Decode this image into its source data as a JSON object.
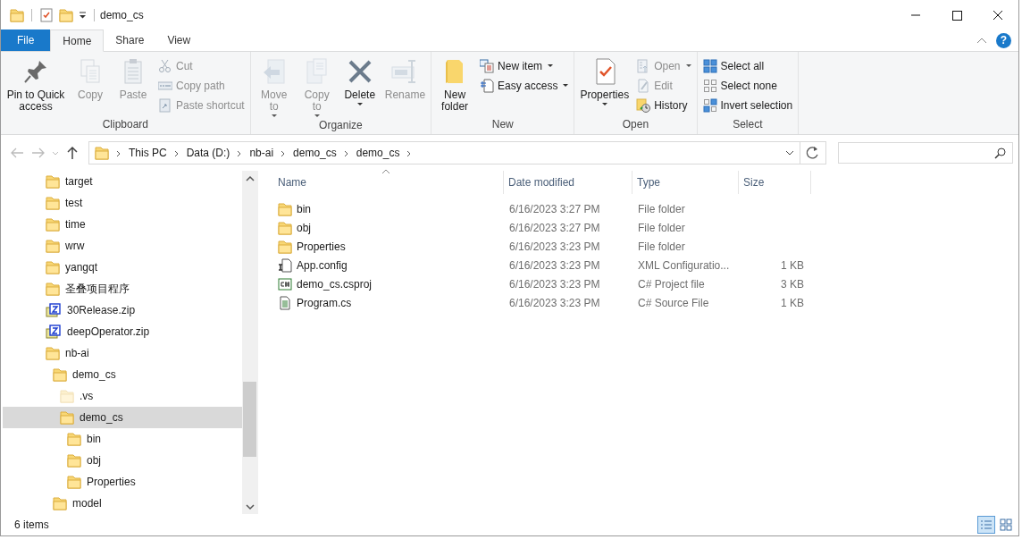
{
  "window": {
    "title": "demo_cs"
  },
  "ribbon_tabs": [
    {
      "label": "File",
      "kind": "file",
      "selected": false
    },
    {
      "label": "Home",
      "kind": "tab",
      "selected": true
    },
    {
      "label": "Share",
      "kind": "tab",
      "selected": false
    },
    {
      "label": "View",
      "kind": "tab",
      "selected": false
    }
  ],
  "help": "?",
  "ribbon_groups": [
    {
      "label": "Clipboard",
      "items": [
        {
          "kind": "large",
          "label": "Pin to Quick access",
          "disabled": false,
          "dropdown": false
        },
        {
          "kind": "large",
          "label": "Copy",
          "disabled": true,
          "dropdown": false
        },
        {
          "kind": "large",
          "label": "Paste",
          "disabled": true,
          "dropdown": false
        },
        {
          "kind": "small",
          "label": "Cut",
          "disabled": true,
          "dropdown": false
        },
        {
          "kind": "small",
          "label": "Copy path",
          "disabled": true,
          "dropdown": false
        },
        {
          "kind": "small",
          "label": "Paste shortcut",
          "disabled": true,
          "dropdown": false
        }
      ]
    },
    {
      "label": "Organize",
      "items": [
        {
          "kind": "large",
          "label": "Move to",
          "disabled": true,
          "dropdown": true
        },
        {
          "kind": "large",
          "label": "Copy to",
          "disabled": true,
          "dropdown": true
        },
        {
          "kind": "large",
          "label": "Delete",
          "disabled": false,
          "dropdown": true
        },
        {
          "kind": "large",
          "label": "Rename",
          "disabled": true,
          "dropdown": false
        }
      ]
    },
    {
      "label": "New",
      "items": [
        {
          "kind": "large",
          "label": "New folder",
          "disabled": false,
          "dropdown": false
        },
        {
          "kind": "small",
          "label": "New item",
          "disabled": false,
          "dropdown": true
        },
        {
          "kind": "small",
          "label": "Easy access",
          "disabled": false,
          "dropdown": true
        }
      ]
    },
    {
      "label": "Open",
      "items": [
        {
          "kind": "large",
          "label": "Properties",
          "disabled": false,
          "dropdown": true
        },
        {
          "kind": "small",
          "label": "Open",
          "disabled": true,
          "dropdown": true
        },
        {
          "kind": "small",
          "label": "Edit",
          "disabled": true,
          "dropdown": false
        },
        {
          "kind": "small",
          "label": "History",
          "disabled": false,
          "dropdown": false
        }
      ]
    },
    {
      "label": "Select",
      "items": [
        {
          "kind": "small",
          "label": "Select all",
          "disabled": false,
          "dropdown": false
        },
        {
          "kind": "small",
          "label": "Select none",
          "disabled": false,
          "dropdown": false
        },
        {
          "kind": "small",
          "label": "Invert selection",
          "disabled": false,
          "dropdown": false
        }
      ]
    }
  ],
  "address": {
    "segments": [
      "This PC",
      "Data (D:)",
      "nb-ai",
      "demo_cs",
      "demo_cs"
    ]
  },
  "nav_tree": [
    {
      "label": "target",
      "kind": "folder",
      "selected": false
    },
    {
      "label": "test",
      "kind": "folder",
      "selected": false
    },
    {
      "label": "time",
      "kind": "folder",
      "selected": false
    },
    {
      "label": "wrw",
      "kind": "folder",
      "selected": false
    },
    {
      "label": "yangqt",
      "kind": "folder",
      "selected": false
    },
    {
      "label": "圣叠项目程序",
      "kind": "folder",
      "selected": false
    },
    {
      "label": "30Release.zip",
      "kind": "zip",
      "selected": false
    },
    {
      "label": "deepOperator.zip",
      "kind": "zip",
      "selected": false
    },
    {
      "label": "nb-ai",
      "kind": "folder",
      "selected": false,
      "children": [
        {
          "label": "demo_cs",
          "kind": "folder",
          "selected": false,
          "children": [
            {
              "label": ".vs",
              "kind": "hidden-folder",
              "selected": false
            },
            {
              "label": "demo_cs",
              "kind": "folder",
              "selected": true,
              "children": [
                {
                  "label": "bin",
                  "kind": "folder",
                  "selected": false
                },
                {
                  "label": "obj",
                  "kind": "folder",
                  "selected": false
                },
                {
                  "label": "Properties",
                  "kind": "folder",
                  "selected": false
                }
              ]
            }
          ]
        },
        {
          "label": "model",
          "kind": "folder",
          "selected": false
        }
      ]
    }
  ],
  "table": {
    "columns": [
      "Name",
      "Date modified",
      "Type",
      "Size"
    ],
    "rows": [
      {
        "name": "bin",
        "date": "6/16/2023 3:27 PM",
        "type": "File folder",
        "size": "",
        "kind": "folder"
      },
      {
        "name": "obj",
        "date": "6/16/2023 3:27 PM",
        "type": "File folder",
        "size": "",
        "kind": "folder"
      },
      {
        "name": "Properties",
        "date": "6/16/2023 3:23 PM",
        "type": "File folder",
        "size": "",
        "kind": "folder"
      },
      {
        "name": "App.config",
        "date": "6/16/2023 3:23 PM",
        "type": "XML Configuratio...",
        "size": "1 KB",
        "kind": "config"
      },
      {
        "name": "demo_cs.csproj",
        "date": "6/16/2023 3:23 PM",
        "type": "C# Project file",
        "size": "3 KB",
        "kind": "csproj"
      },
      {
        "name": "Program.cs",
        "date": "6/16/2023 3:23 PM",
        "type": "C# Source File",
        "size": "1 KB",
        "kind": "source"
      }
    ]
  },
  "status_bar": {
    "count": "6 items"
  }
}
